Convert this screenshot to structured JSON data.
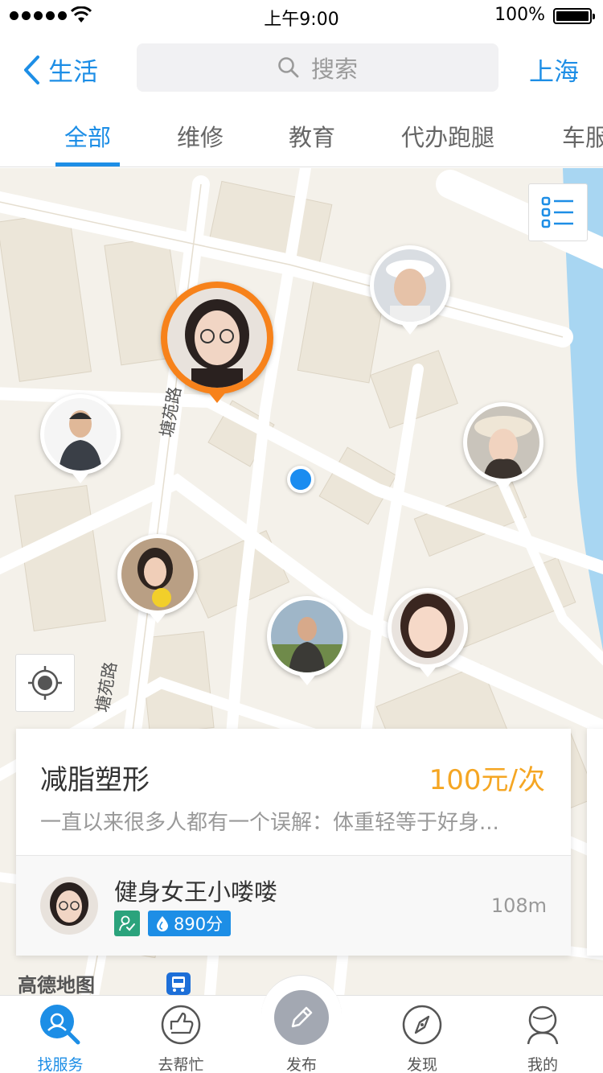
{
  "status_bar": {
    "time": "上午9:00",
    "battery": "100%"
  },
  "nav": {
    "back_label": "生活",
    "search_placeholder": "搜索",
    "city": "上海"
  },
  "tabs": [
    {
      "label": "全部",
      "active": true
    },
    {
      "label": "维修",
      "active": false
    },
    {
      "label": "教育",
      "active": false
    },
    {
      "label": "代办跑腿",
      "active": false
    },
    {
      "label": "车服",
      "active": false
    }
  ],
  "map": {
    "road_labels": [
      "塘苑路",
      "塘苑路"
    ],
    "logo": "高德地图",
    "markers": [
      {
        "name": "featured-provider",
        "featured": true
      },
      {
        "name": "provider",
        "featured": false
      }
    ]
  },
  "card": {
    "title": "减脂塑形",
    "price": "100元/次",
    "description": "一直以来很多人都有一个误解：体重轻等于好身...",
    "provider_name": "健身女王小喽喽",
    "score": "890分",
    "distance": "108m"
  },
  "bottom_tabs": [
    {
      "label": "找服务",
      "icon": "search-service-icon",
      "active": true
    },
    {
      "label": "去帮忙",
      "icon": "thumbs-up-icon",
      "active": false
    },
    {
      "label": "发布",
      "icon": "pencil-icon",
      "active": false
    },
    {
      "label": "发现",
      "icon": "compass-icon",
      "active": false
    },
    {
      "label": "我的",
      "icon": "profile-icon",
      "active": false
    }
  ],
  "colors": {
    "accent": "#1d8ee6",
    "price": "#f5a623",
    "featured_ring": "#f7821b",
    "map_bg": "#f4f1ea",
    "water": "#a8d6f2"
  }
}
